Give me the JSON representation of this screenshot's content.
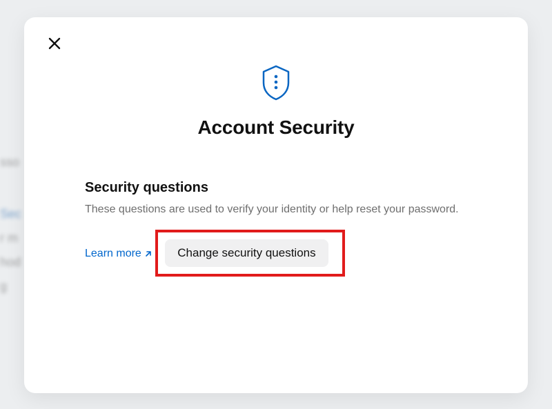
{
  "background": {
    "sidebar_fragments": [
      "sso",
      "Sec",
      "r m",
      "hod",
      "g"
    ]
  },
  "modal": {
    "title": "Account Security",
    "section": {
      "title": "Security questions",
      "description": "These questions are used to verify your identity or help reset your password.",
      "learn_more_label": "Learn more",
      "button_label": "Change security questions"
    }
  }
}
